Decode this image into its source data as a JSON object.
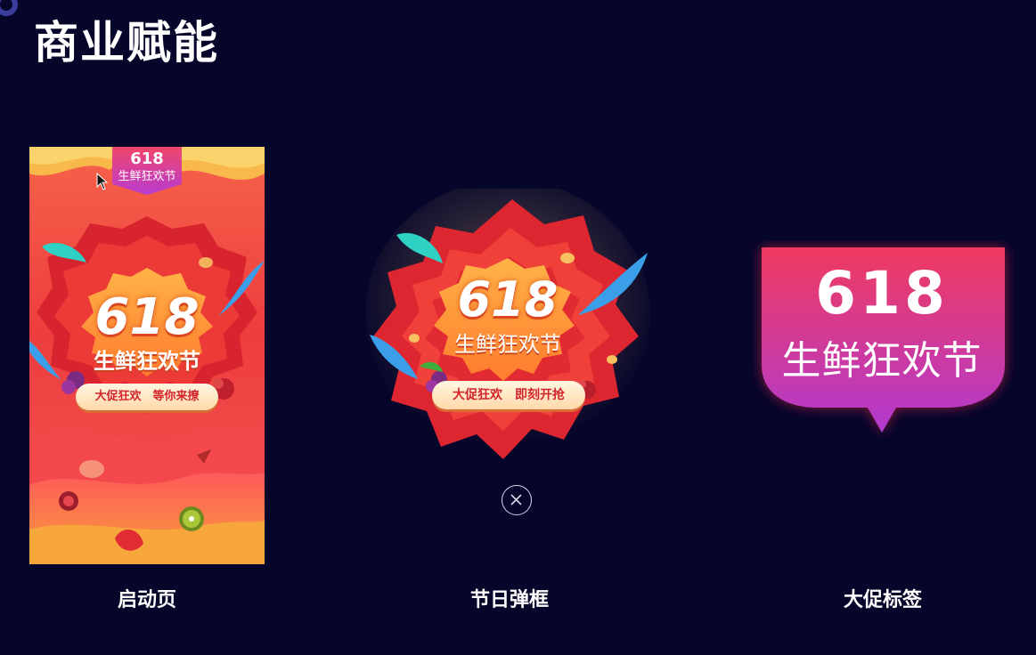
{
  "page": {
    "title": "商业赋能"
  },
  "launch_page": {
    "caption": "启动页",
    "tag_number": "618",
    "tag_text": "生鲜狂欢节",
    "hero_number": "618",
    "hero_text": "生鲜狂欢节",
    "slogan": "大促狂欢　等你来撩"
  },
  "holiday_popup": {
    "caption": "节日弹框",
    "hero_number": "618",
    "hero_text": "生鲜狂欢节",
    "slogan": "大促狂欢　即刻开抢",
    "close_icon": "close-icon"
  },
  "promo_tag": {
    "caption": "大促标签",
    "number": "618",
    "text": "生鲜狂欢节"
  },
  "colors": {
    "background": "#06052a",
    "festival_red": "#ee3d3d",
    "badge_top": "#f03a5f",
    "badge_bottom": "#b23ad0",
    "accent_ring": "#3b3d9c"
  }
}
